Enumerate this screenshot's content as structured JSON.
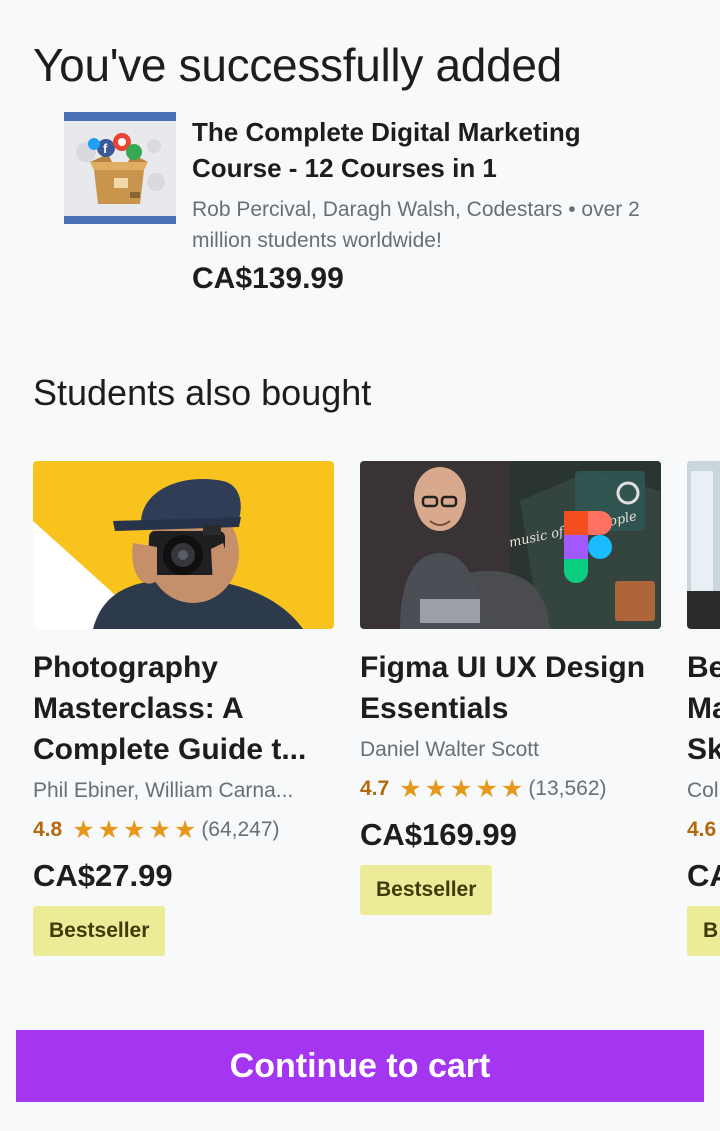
{
  "heading": "You've successfully added",
  "added_course": {
    "title": "The Complete Digital Marketing Course - 12 Courses in 1",
    "meta": "Rob Percival, Daragh Walsh, Codestars • over 2 million students worldwide!",
    "price": "CA$139.99",
    "thumbnail_icon": "box-of-social-icons"
  },
  "section_title": "Students also bought",
  "cards": [
    {
      "title": "Photography Masterclass: A Complete Guide t...",
      "title_lines": [
        "Photography",
        "Masterclass: A",
        "Complete Guide t..."
      ],
      "author": "Phil Ebiner, William Carna...",
      "rating": "4.8",
      "stars": 5,
      "reviews": "(64,247)",
      "price": "CA$27.99",
      "badge": "Bestseller",
      "image_colors": [
        "#f9c31d",
        "#ffffff"
      ]
    },
    {
      "title": "Figma UI UX Design Essentials",
      "title_lines": [
        "Figma UI UX Design",
        "Essentials"
      ],
      "author": "Daniel Walter Scott",
      "rating": "4.7",
      "stars": 5,
      "reviews": "(13,562)",
      "price": "CA$169.99",
      "badge": "Bestseller",
      "image_text": "music of our people",
      "image_colors": [
        "#3a3036",
        "#2c3e3a"
      ]
    },
    {
      "title_lines": [
        "Be",
        "Ma",
        "Sk"
      ],
      "author": "Col",
      "rating": "4.6",
      "price": "CA",
      "badge": "B"
    }
  ],
  "cta_label": "Continue to cart",
  "colors": {
    "accent": "#a435f0",
    "rating": "#b4690e",
    "star": "#e59819",
    "badge_bg": "#eceb98",
    "background": "#f7f9fa"
  }
}
